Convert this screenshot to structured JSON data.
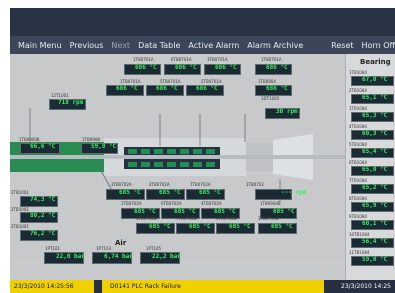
{
  "menu": {
    "main_menu": "Main Menu",
    "previous": "Previous",
    "next": "Next",
    "data_table": "Data Table",
    "active_alarm": "Active Alarm",
    "alarm_archive": "Alarm Archive",
    "reset": "Reset",
    "horn_off": "Horn Off"
  },
  "bearing": {
    "title": "Bearing",
    "values": [
      "67,0 °C",
      "65,1 °C",
      "65,3 °C",
      "60,3 °C",
      "65,4 °C",
      "65,0 °C",
      "65,2 °C",
      "65,9 °C",
      "60,1 °C",
      "56,4 °C",
      "59,0 °C"
    ]
  },
  "top_values": [
    "686 °C",
    "686 °C",
    "686 °C",
    "686 °C",
    "686 °C",
    "686 °C",
    "686 °C",
    "686 °C"
  ],
  "bottom_values": [
    "685 °C",
    "685 °C",
    "685 °C",
    "685 °C",
    "685 °C",
    "685 °C",
    "685 °C",
    "685 °C"
  ],
  "rpm_left": "718 rpm",
  "rpm_right": "30 rpm",
  "rpm_small": "--- rpm",
  "left_temps": [
    "66,6 °C",
    "59,8 °C"
  ],
  "left_column": [
    "74,3 °C",
    "80,2 °C",
    "76,2 °C"
  ],
  "air": {
    "title": "Air",
    "values": [
      "22,0 bar",
      "6,74 bar",
      "22,2 bar"
    ]
  },
  "status": {
    "left": "23/3/2010 14:25:56",
    "middle": "D0141 PLC Rack Failure",
    "right": "23/3/2010 14:25"
  }
}
